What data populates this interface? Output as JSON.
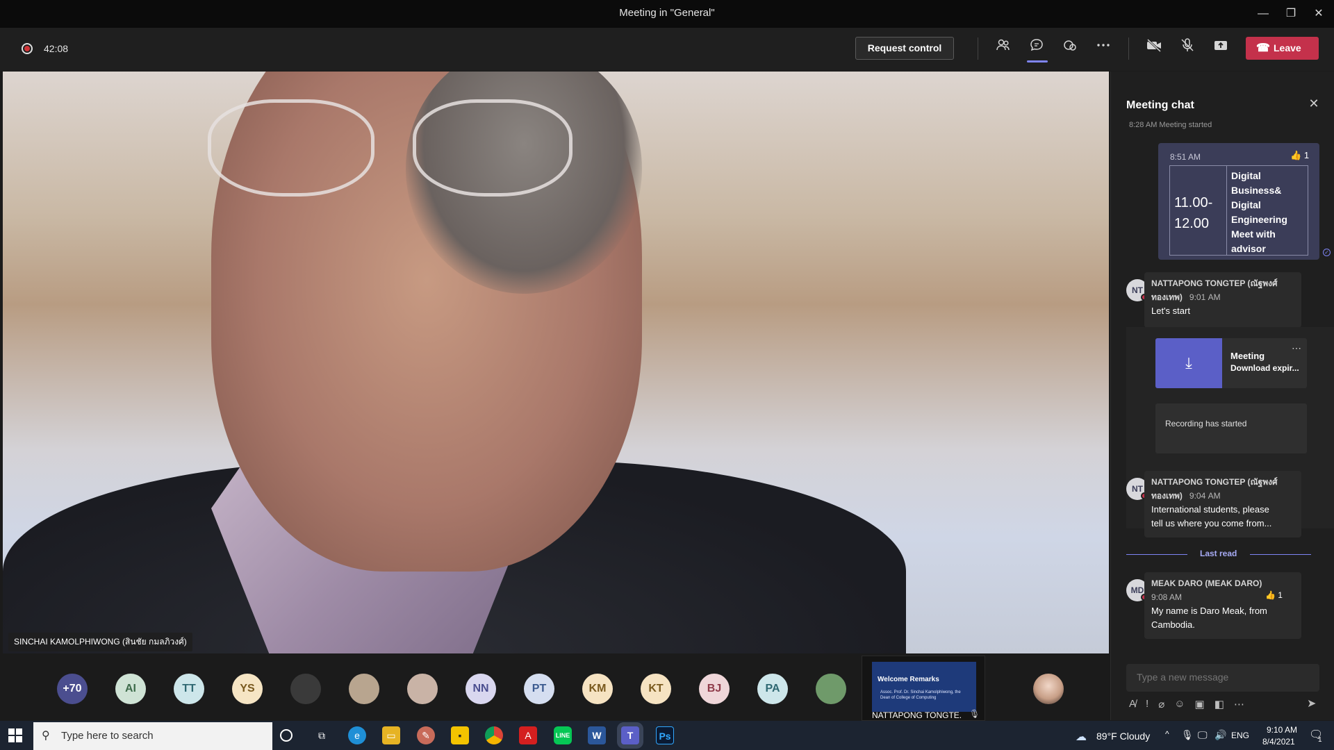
{
  "window": {
    "title": "Meeting in \"General\"",
    "minimize_label": "—",
    "restore_label": "❐",
    "close_label": "✕"
  },
  "toolbar": {
    "timer": "42:08",
    "request_control": "Request control",
    "leave": "Leave"
  },
  "video": {
    "speaker_name": "SINCHAI KAMOLPHIWONG (สินชัย กมลภิวงศ์)"
  },
  "chat": {
    "title": "Meeting chat",
    "system_line": "8:28 AM   Meeting started",
    "own_message": {
      "time": "8:51 AM",
      "reaction_count": "1",
      "left_cell": "11.00-\n12.00",
      "right_cell": "Digital Business& Digital Engineering Meet with advisor"
    },
    "messages": [
      {
        "initials": "NT",
        "sender_line1": "NATTAPONG TONGTEP (ณัฐพงศ์",
        "sender_line2": "ทองเทพ)",
        "time": "9:01 AM",
        "text": "Let's start"
      },
      {
        "initials": "NT",
        "sender_line1": "NATTAPONG TONGTEP (ณัฐพงศ์",
        "sender_line2": "ทองเทพ)",
        "time": "9:04 AM",
        "text_line1": "International students, please",
        "text_line2": "tell us where you come from..."
      },
      {
        "initials": "MD",
        "sender_line1": "MEAK DARO (MEAK DARO)",
        "time": "9:08 AM",
        "reaction_count": "1",
        "text_line1": "My name is Daro Meak, from",
        "text_line2": "Cambodia."
      }
    ],
    "recording_card": {
      "title": "Meeting",
      "subtitle": "Download expir...",
      "status": "Recording has started"
    },
    "last_read": "Last read",
    "compose_placeholder": "Type a new message"
  },
  "participants": [
    {
      "label": "+70",
      "bg": "#4b4e8f",
      "fg": "#ffffff"
    },
    {
      "label": "AI",
      "bg": "#cfe3d5",
      "fg": "#3d6b4a"
    },
    {
      "label": "TT",
      "bg": "#cde6ea",
      "fg": "#2f6872"
    },
    {
      "label": "YS",
      "bg": "#f6e5c4",
      "fg": "#7a5a1f"
    },
    {
      "label": "",
      "bg": "#3a3a3a",
      "fg": "#ffffff"
    },
    {
      "label": "",
      "bg": "#b8a58f",
      "fg": "#ffffff"
    },
    {
      "label": "",
      "bg": "#c9b3a6",
      "fg": "#ffffff"
    },
    {
      "label": "NN",
      "bg": "#d9d7ef",
      "fg": "#4b4e8f"
    },
    {
      "label": "PT",
      "bg": "#d5def0",
      "fg": "#3b5a8f"
    },
    {
      "label": "KM",
      "bg": "#f6e3c2",
      "fg": "#7a5a1f"
    },
    {
      "label": "KT",
      "bg": "#f6e3c2",
      "fg": "#7a5a1f"
    },
    {
      "label": "BJ",
      "bg": "#efd6d9",
      "fg": "#8f3b4a"
    },
    {
      "label": "PA",
      "bg": "#cde6ea",
      "fg": "#2f6872"
    },
    {
      "label": "",
      "bg": "#6f9a6a",
      "fg": "#ffffff"
    }
  ],
  "share_tile": {
    "slide_title": "Welcome Remarks",
    "slide_sub": "Assoc. Prof. Dr. Sinchai Kamolphiwong, the Dean of College of Computing",
    "name": "NATTAPONG TONGTE..."
  },
  "taskbar": {
    "search_placeholder": "Type here to search",
    "weather": "89°F  Cloudy",
    "lang": "ENG",
    "time": "9:10 AM",
    "date": "8/4/2021",
    "notif_count": "1"
  },
  "colors": {
    "accent": "#7f85f5",
    "leave": "#c4314b",
    "taskbar": "#1c2431"
  }
}
